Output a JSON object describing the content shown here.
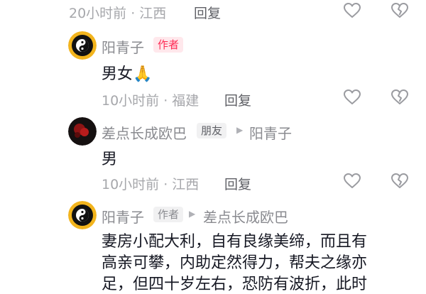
{
  "comments": [
    {
      "meta": "20小时前 · 江西",
      "reply": "回复"
    },
    {
      "username": "阳青子",
      "author_tag": "作者",
      "text": "男女",
      "emoji": "🙏",
      "meta": "10小时前 · 福建",
      "reply": "回复"
    },
    {
      "username": "差点长成欧巴",
      "friend_tag": "朋友",
      "reply_to": "阳青子",
      "text": "男",
      "meta": "10小时前 · 江西",
      "reply": "回复"
    },
    {
      "username": "阳青子",
      "author_tag": "作者",
      "reply_to": "差点长成欧巴",
      "text_lines": [
        "妻房小配大利，自有良缘美缔，而且有",
        "高亲可攀，内助定然得力，帮夫之缘亦",
        "足，但四十岁左右，恐防有波折，此时"
      ]
    }
  ],
  "icons": [
    "heart-outline-icon",
    "broken-heart-icon",
    "play-triangle-icon"
  ]
}
